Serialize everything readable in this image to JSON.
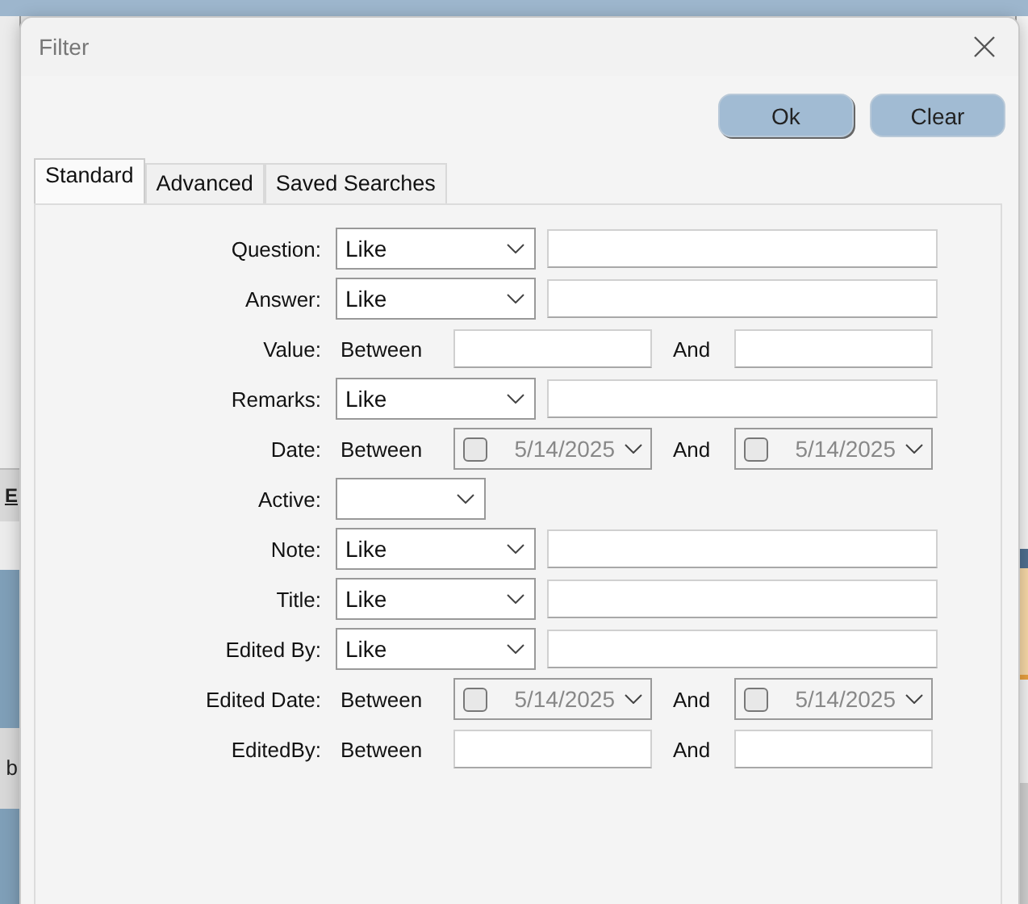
{
  "background": {
    "left_fragments": [
      "E",
      "b"
    ]
  },
  "window": {
    "title": "Filter"
  },
  "buttons": [
    "Ok",
    "Clear"
  ],
  "tabs": [
    {
      "label": "Standard",
      "selected": true
    },
    {
      "label": "Advanced",
      "selected": false
    },
    {
      "label": "Saved Searches",
      "selected": false
    }
  ],
  "criteria": [
    {
      "label": "Question:",
      "kind": "like",
      "operator": "Like"
    },
    {
      "label": "Answer:",
      "kind": "like",
      "operator": "Like"
    },
    {
      "label": "Value:",
      "kind": "between",
      "operator": "Between",
      "connector": "And"
    },
    {
      "label": "Remarks:",
      "kind": "like",
      "operator": "Like"
    },
    {
      "label": "Date:",
      "kind": "date_range",
      "operator": "Between",
      "connector": "And",
      "from": {
        "value": "5/14/2025",
        "checked": false
      },
      "to": {
        "value": "5/14/2025",
        "checked": false
      }
    },
    {
      "label": "Active:",
      "kind": "dropdown"
    },
    {
      "label": "Note:",
      "kind": "like",
      "operator": "Like"
    },
    {
      "label": "Title:",
      "kind": "like",
      "operator": "Like"
    },
    {
      "label": "Edited By:",
      "kind": "like",
      "operator": "Like"
    },
    {
      "label": "Edited Date:",
      "kind": "date_range",
      "operator": "Between",
      "connector": "And",
      "from": {
        "value": "5/14/2025",
        "checked": false
      },
      "to": {
        "value": "5/14/2025",
        "checked": false
      }
    },
    {
      "label": "EditedBy:",
      "kind": "between",
      "operator": "Between",
      "connector": "And"
    }
  ]
}
